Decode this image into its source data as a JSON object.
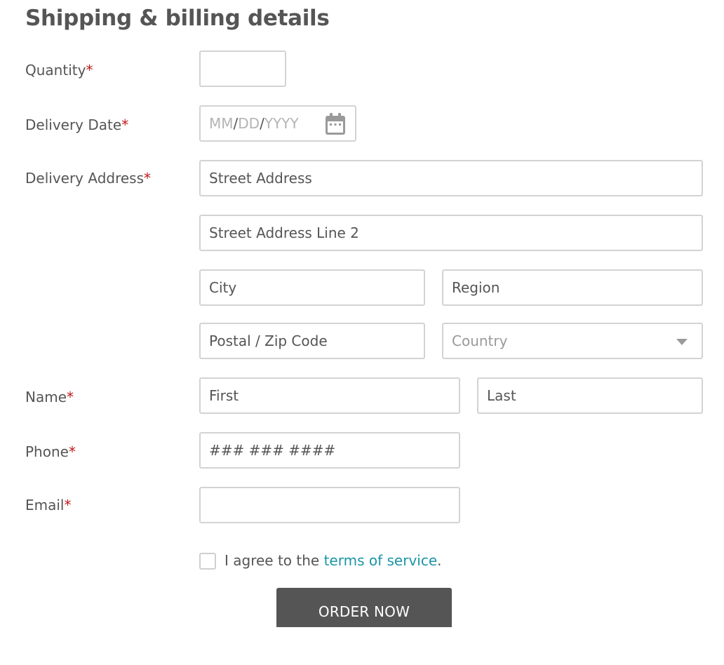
{
  "form": {
    "title": "Shipping & billing details",
    "required_mark": "*"
  },
  "labels": {
    "quantity": "Quantity",
    "delivery_date": "Delivery Date",
    "delivery_address": "Delivery Address",
    "name": "Name",
    "phone": "Phone",
    "email": "Email"
  },
  "fields": {
    "quantity": {
      "value": ""
    },
    "delivery_date": {
      "month": "MM",
      "day": "DD",
      "year": "YYYY",
      "separator": "/",
      "icon": "calendar-icon"
    },
    "street_address": {
      "placeholder": "Street Address"
    },
    "street_address_2": {
      "placeholder": "Street Address Line 2"
    },
    "city": {
      "placeholder": "City"
    },
    "region": {
      "placeholder": "Region"
    },
    "postal": {
      "placeholder": "Postal / Zip Code"
    },
    "country": {
      "placeholder": "Country",
      "icon": "chevron-down-icon"
    },
    "first_name": {
      "placeholder": "First"
    },
    "last_name": {
      "placeholder": "Last"
    },
    "phone": {
      "placeholder": "### ### ####"
    },
    "email": {
      "value": ""
    }
  },
  "terms": {
    "prefix": "I agree to the ",
    "link": "terms of service",
    "suffix": ".",
    "checked": false
  },
  "submit": {
    "label": "ORDER NOW"
  },
  "colors": {
    "text": "#555555",
    "required": "#c3191b",
    "link": "#1a95a6",
    "border": "#d3d3d3",
    "button_bg": "#555555",
    "button_text": "#ffffff"
  }
}
